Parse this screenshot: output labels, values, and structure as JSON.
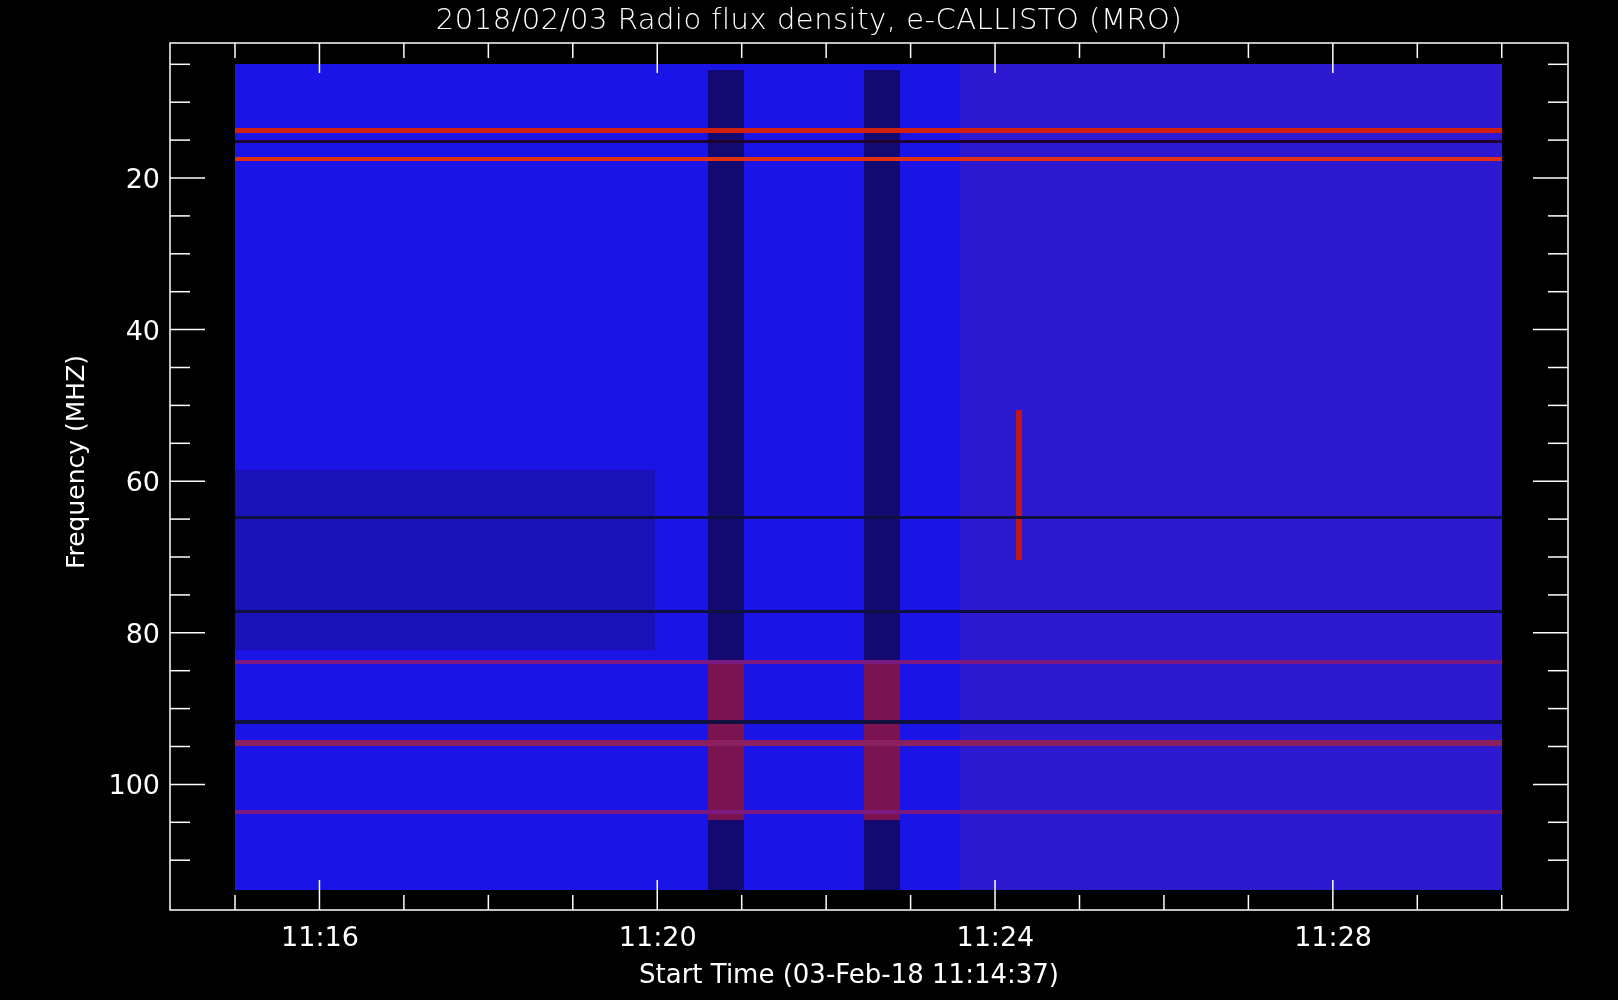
{
  "plot": {
    "title": "2018/02/03  Radio flux density, e-CALLISTO (MRO)",
    "ylabel": "Frequency (MHZ)",
    "xlabel": "Start Time (03-Feb-18 11:14:37)",
    "yticks": [
      "20",
      "40",
      "60",
      "80",
      "100"
    ],
    "xticks": [
      "11:16",
      "11:20",
      "11:24",
      "11:28"
    ]
  }
}
